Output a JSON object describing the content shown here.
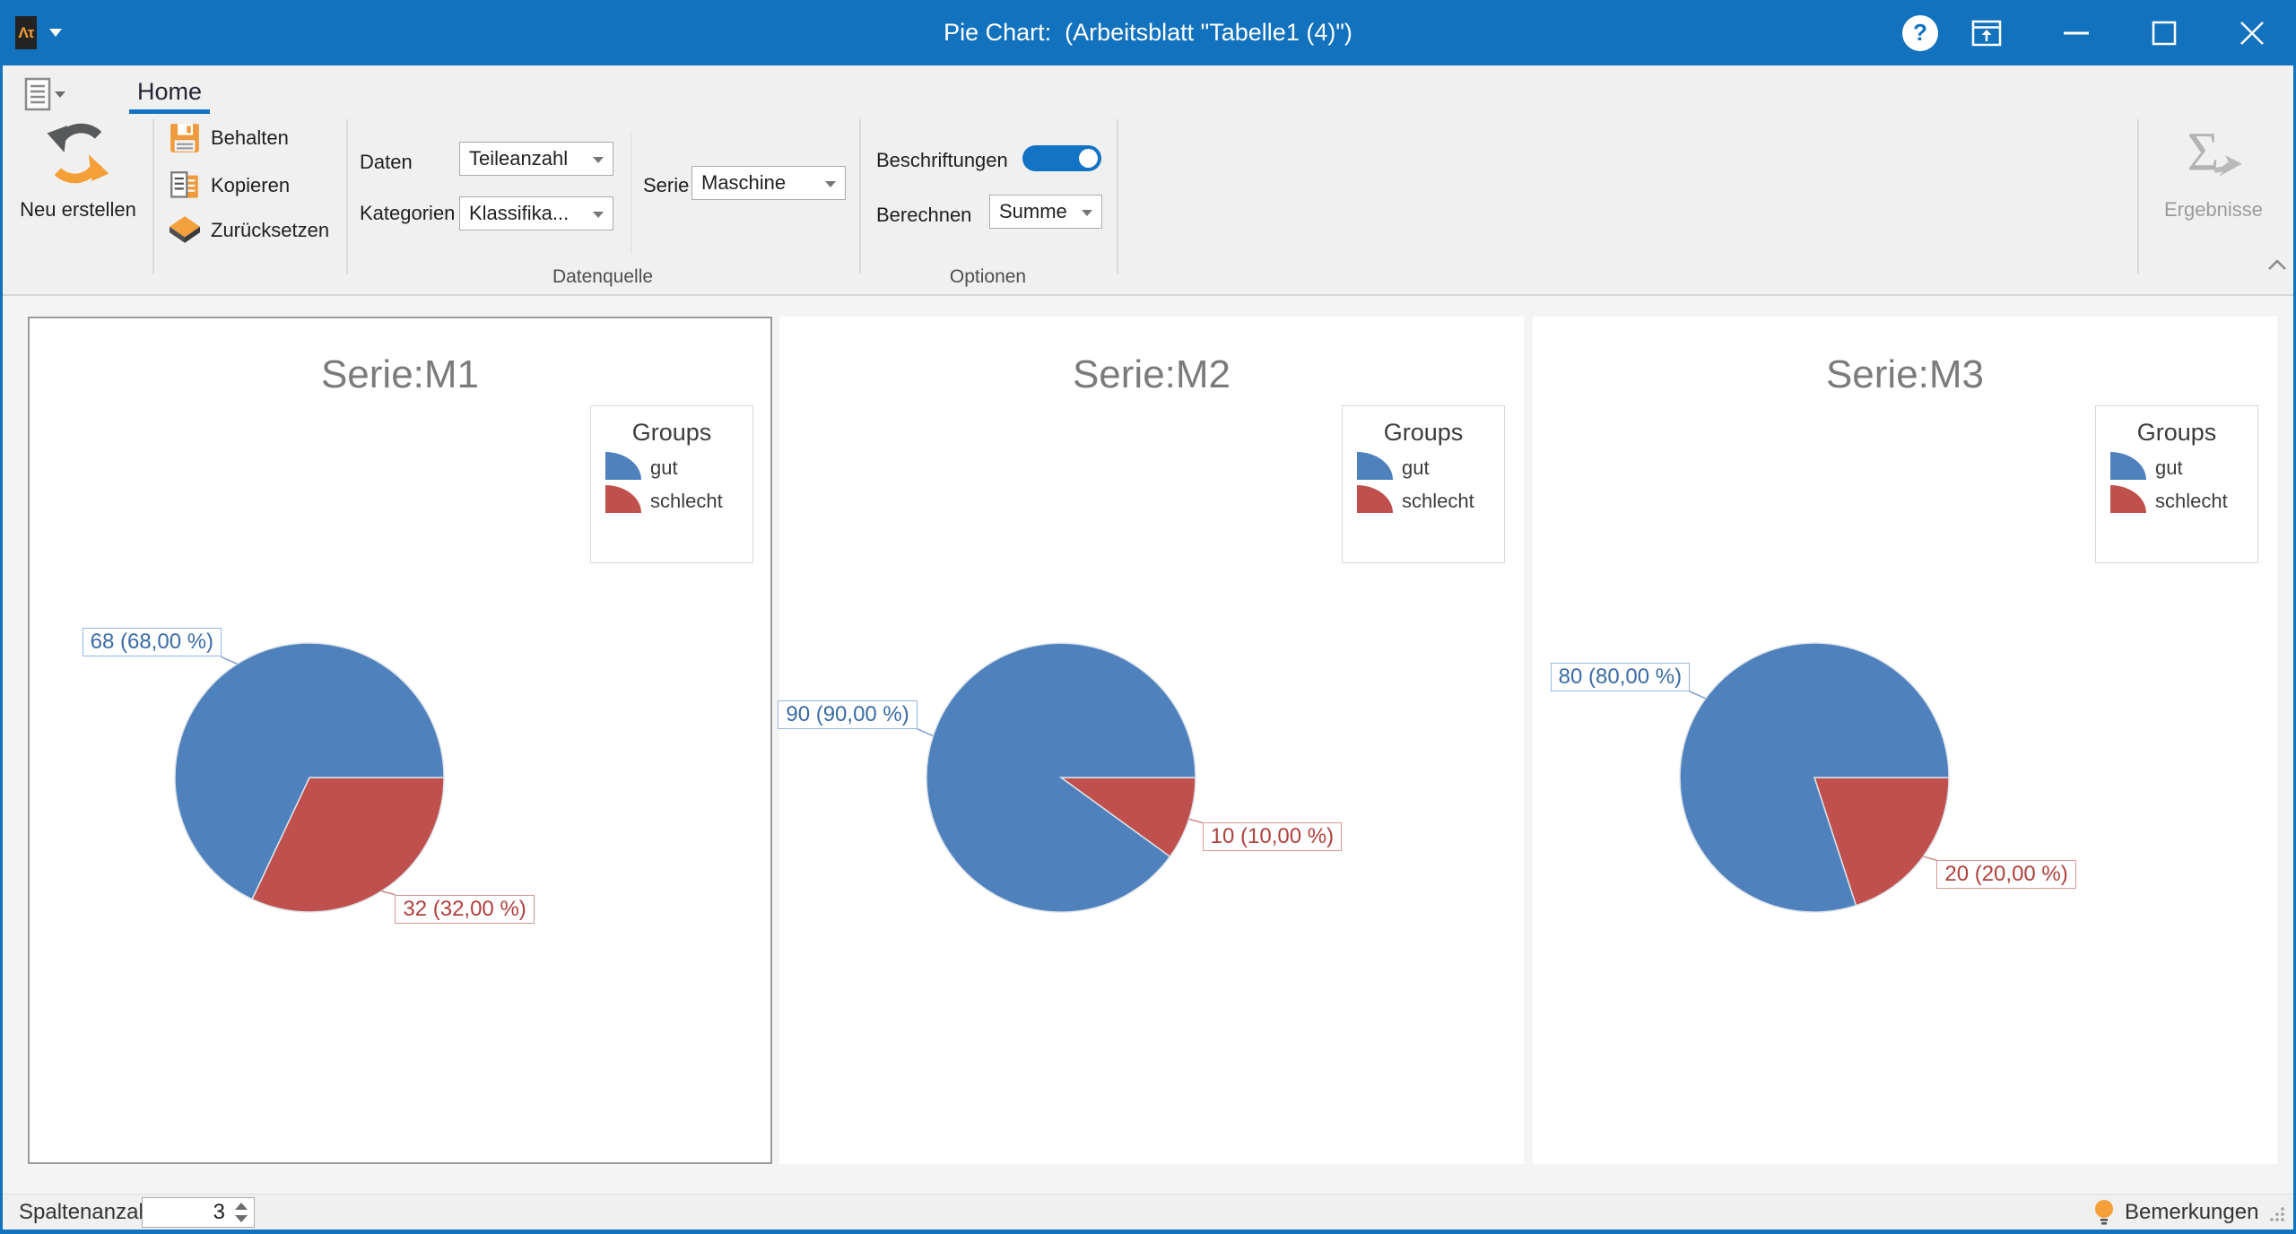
{
  "window": {
    "title": "Pie Chart:  (Arbeitsblatt \"Tabelle1 (4)\")",
    "app_icon_text": "Λτ",
    "icons": [
      "help-icon",
      "popout-window-icon",
      "minimize-icon",
      "maximize-icon",
      "close-icon"
    ]
  },
  "ribbon": {
    "tab": "Home",
    "neu_erstellen": "Neu erstellen",
    "behalten": "Behalten",
    "kopieren": "Kopieren",
    "zuruecksetzen": "Zurücksetzen",
    "daten_label": "Daten",
    "daten_value": "Teileanzahl",
    "kategorien_label": "Kategorien",
    "kategorien_value": "Klassifika...",
    "serie_label": "Serie",
    "serie_value": "Maschine",
    "beschriftungen_label": "Beschriftungen",
    "beschriftungen_on": true,
    "berechnen_label": "Berechnen",
    "berechnen_value": "Summe",
    "group_datenquelle": "Datenquelle",
    "group_optionen": "Optionen",
    "ergebnisse": "Ergebnisse"
  },
  "statusbar": {
    "spaltenanzahl_label": "Spaltenanzahl",
    "spaltenanzahl_value": "3",
    "bemerkungen_label": "Bemerkungen"
  },
  "colors": {
    "accent": "#1272be",
    "series_blue": "#4f81bd",
    "series_red": "#c0504d",
    "blue_label_text": "#3a6ba5",
    "blue_label_border": "#94b7e0",
    "red_label_text": "#ae403d",
    "red_label_border": "#d59a98"
  },
  "chart_data": [
    {
      "type": "pie",
      "title": "Serie:M1",
      "legend_title": "Groups",
      "legend_position": "top-right",
      "selected": true,
      "slices": [
        {
          "name": "gut",
          "value": 68,
          "label": "68 (68,00 %)",
          "color": "#4f81bd"
        },
        {
          "name": "schlecht",
          "value": 32,
          "label": "32 (32,00 %)",
          "color": "#c0504d"
        }
      ]
    },
    {
      "type": "pie",
      "title": "Serie:M2",
      "legend_title": "Groups",
      "legend_position": "top-right",
      "selected": false,
      "slices": [
        {
          "name": "gut",
          "value": 90,
          "label": "90 (90,00 %)",
          "color": "#4f81bd"
        },
        {
          "name": "schlecht",
          "value": 10,
          "label": "10 (10,00 %)",
          "color": "#c0504d"
        }
      ]
    },
    {
      "type": "pie",
      "title": "Serie:M3",
      "legend_title": "Groups",
      "legend_position": "top-right",
      "selected": false,
      "slices": [
        {
          "name": "gut",
          "value": 80,
          "label": "80 (80,00 %)",
          "color": "#4f81bd"
        },
        {
          "name": "schlecht",
          "value": 20,
          "label": "20 (20,00 %)",
          "color": "#c0504d"
        }
      ]
    }
  ]
}
